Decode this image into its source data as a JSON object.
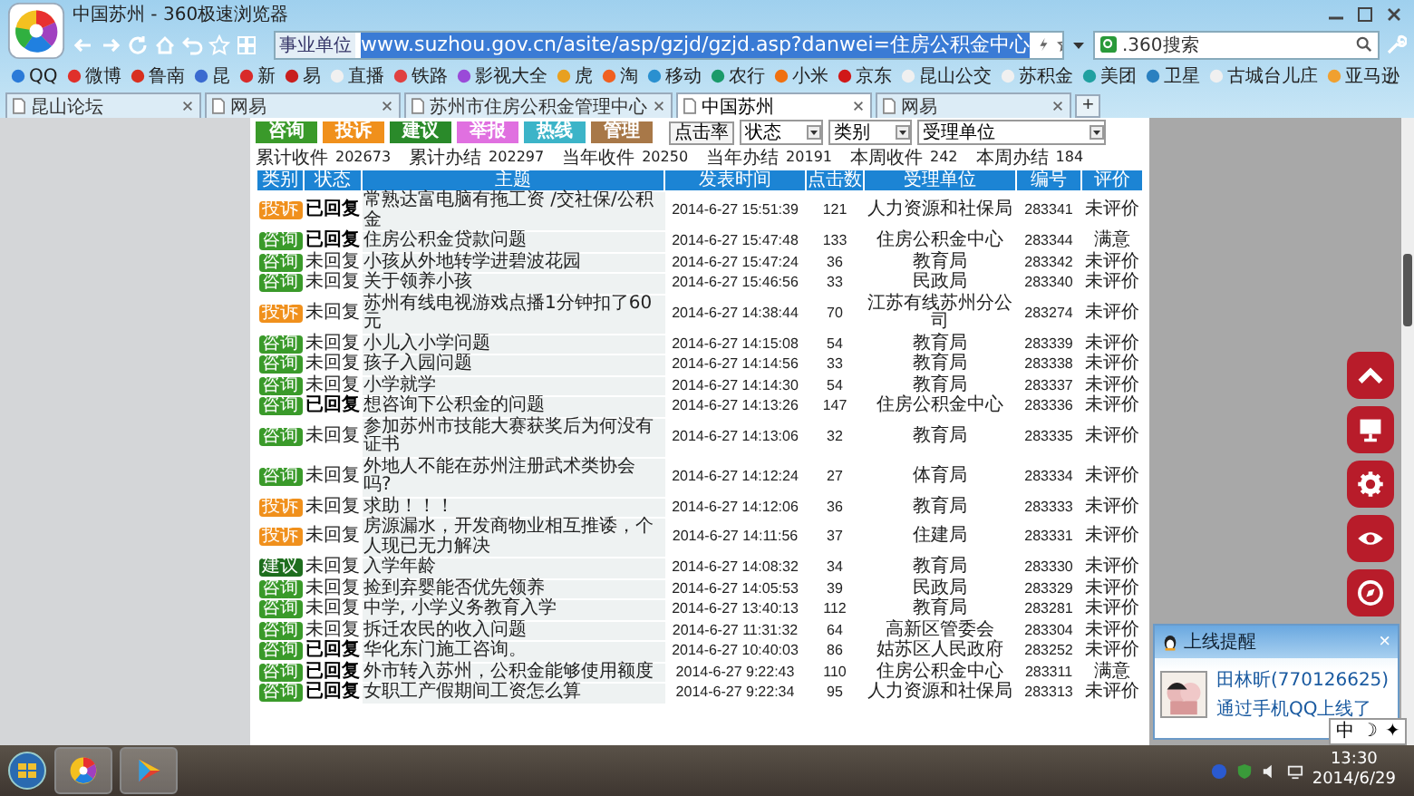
{
  "window": {
    "title": "中国苏州 - 360极速浏览器"
  },
  "address_bar": {
    "tag": "事业单位",
    "url": "www.suzhou.gov.cn/asite/asp/gzjd/gzjd.asp?danwei=住房公积金中心"
  },
  "search": {
    "value": ".360搜索"
  },
  "bookmarks": [
    {
      "label": "QQ",
      "color": "#2a7ad8"
    },
    {
      "label": "微博",
      "color": "#e0302a"
    },
    {
      "label": "鲁南",
      "color": "#d83020"
    },
    {
      "label": "昆",
      "color": "#3a6ad0"
    },
    {
      "label": "新",
      "color": "#d82a2a"
    },
    {
      "label": "易",
      "color": "#c81e1e"
    },
    {
      "label": "直播",
      "color": "#f0f0f0"
    },
    {
      "label": "铁路",
      "color": "#e04040"
    },
    {
      "label": "影视大全",
      "color": "#9a4ad8"
    },
    {
      "label": "虎",
      "color": "#e8a020"
    },
    {
      "label": "淘",
      "color": "#f06020"
    },
    {
      "label": "移动",
      "color": "#2a90d0"
    },
    {
      "label": "农行",
      "color": "#1a9a6a"
    },
    {
      "label": "小米",
      "color": "#f07010"
    },
    {
      "label": "京东",
      "color": "#d01818"
    },
    {
      "label": "昆山公交",
      "color": "#f0f0f0"
    },
    {
      "label": "苏积金",
      "color": "#f0f0f0"
    },
    {
      "label": "美团",
      "color": "#20a0a0"
    },
    {
      "label": "卫星",
      "color": "#2a80c0"
    },
    {
      "label": "古城台儿庄",
      "color": "#f0f0f0"
    },
    {
      "label": "亚马逊",
      "color": "#f0a030"
    }
  ],
  "tabs": [
    {
      "label": "昆山论坛",
      "selected": false
    },
    {
      "label": "网易",
      "selected": false
    },
    {
      "label": "苏州市住房公积金管理中心",
      "selected": false
    },
    {
      "label": "中国苏州",
      "selected": true
    },
    {
      "label": "网易",
      "selected": false
    }
  ],
  "new_tab": "+",
  "page": {
    "category_buttons": [
      {
        "label": "咨询",
        "color": "#3a9a2a"
      },
      {
        "label": "投诉",
        "color": "#f0901c"
      },
      {
        "label": "建议",
        "color": "#2a8a2a"
      },
      {
        "label": "举报",
        "color": "#e070e0"
      },
      {
        "label": "热线",
        "color": "#3cb4c8"
      },
      {
        "label": "管理",
        "color": "#a87848"
      }
    ],
    "sort_button": "点击率",
    "filters": [
      "状态",
      "类别",
      "受理单位"
    ],
    "stats": [
      {
        "label": "累计收件",
        "value": "202673"
      },
      {
        "label": "累计办结",
        "value": "202297"
      },
      {
        "label": "当年收件",
        "value": "20250"
      },
      {
        "label": "当年办结",
        "value": "20191"
      },
      {
        "label": "本周收件",
        "value": "242"
      },
      {
        "label": "本周办结",
        "value": "184"
      }
    ],
    "columns": [
      "类别",
      "状态",
      "主题",
      "发表时间",
      "点击数",
      "受理单位",
      "编号",
      "评价"
    ],
    "rows": [
      {
        "category": {
          "label": "投诉",
          "color": "#f0901c"
        },
        "status": "已回复",
        "replied": true,
        "subject": "常熟达富电脑有拖工资 /交社保/公积金",
        "time": "2014-6-27 15:51:39",
        "clicks": "121",
        "unit": "人力资源和社保局",
        "number": "283341",
        "rating": "未评价"
      },
      {
        "category": {
          "label": "咨询",
          "color": "#3a9a2a"
        },
        "status": "已回复",
        "replied": true,
        "subject": "住房公积金贷款问题",
        "time": "2014-6-27 15:47:48",
        "clicks": "133",
        "unit": "住房公积金中心",
        "number": "283344",
        "rating": "满意"
      },
      {
        "category": {
          "label": "咨询",
          "color": "#3a9a2a"
        },
        "status": "未回复",
        "replied": false,
        "subject": "小孩从外地转学进碧波花园",
        "time": "2014-6-27 15:47:24",
        "clicks": "36",
        "unit": "教育局",
        "number": "283342",
        "rating": "未评价"
      },
      {
        "category": {
          "label": "咨询",
          "color": "#3a9a2a"
        },
        "status": "未回复",
        "replied": false,
        "subject": "关于领养小孩",
        "time": "2014-6-27 15:46:56",
        "clicks": "33",
        "unit": "民政局",
        "number": "283340",
        "rating": "未评价"
      },
      {
        "category": {
          "label": "投诉",
          "color": "#f0901c"
        },
        "status": "未回复",
        "replied": false,
        "subject": "苏州有线电视游戏点播1分钟扣了60元",
        "time": "2014-6-27 14:38:44",
        "clicks": "70",
        "unit": "江苏有线苏州分公司",
        "number": "283274",
        "rating": "未评价"
      },
      {
        "category": {
          "label": "咨询",
          "color": "#3a9a2a"
        },
        "status": "未回复",
        "replied": false,
        "subject": "小儿入小学问题",
        "time": "2014-6-27 14:15:08",
        "clicks": "54",
        "unit": "教育局",
        "number": "283339",
        "rating": "未评价"
      },
      {
        "category": {
          "label": "咨询",
          "color": "#3a9a2a"
        },
        "status": "未回复",
        "replied": false,
        "subject": "孩子入园问题",
        "time": "2014-6-27 14:14:56",
        "clicks": "33",
        "unit": "教育局",
        "number": "283338",
        "rating": "未评价"
      },
      {
        "category": {
          "label": "咨询",
          "color": "#3a9a2a"
        },
        "status": "未回复",
        "replied": false,
        "subject": "小学就学",
        "time": "2014-6-27 14:14:30",
        "clicks": "54",
        "unit": "教育局",
        "number": "283337",
        "rating": "未评价"
      },
      {
        "category": {
          "label": "咨询",
          "color": "#3a9a2a"
        },
        "status": "已回复",
        "replied": true,
        "subject": "想咨询下公积金的问题",
        "time": "2014-6-27 14:13:26",
        "clicks": "147",
        "unit": "住房公积金中心",
        "number": "283336",
        "rating": "未评价"
      },
      {
        "category": {
          "label": "咨询",
          "color": "#3a9a2a"
        },
        "status": "未回复",
        "replied": false,
        "subject": "参加苏州市技能大赛获奖后为何没有证书",
        "time": "2014-6-27 14:13:06",
        "clicks": "32",
        "unit": "教育局",
        "number": "283335",
        "rating": "未评价"
      },
      {
        "category": {
          "label": "咨询",
          "color": "#3a9a2a"
        },
        "status": "未回复",
        "replied": false,
        "subject": "外地人不能在苏州注册武术类协会吗?",
        "time": "2014-6-27 14:12:24",
        "clicks": "27",
        "unit": "体育局",
        "number": "283334",
        "rating": "未评价"
      },
      {
        "category": {
          "label": "投诉",
          "color": "#f0901c"
        },
        "status": "未回复",
        "replied": false,
        "subject": "求助！！！",
        "time": "2014-6-27 14:12:06",
        "clicks": "36",
        "unit": "教育局",
        "number": "283333",
        "rating": "未评价"
      },
      {
        "category": {
          "label": "投诉",
          "color": "#f0901c"
        },
        "status": "未回复",
        "replied": false,
        "subject": "房源漏水，开发商物业相互推诿，个人现已无力解决",
        "time": "2014-6-27 14:11:56",
        "clicks": "37",
        "unit": "住建局",
        "number": "283331",
        "rating": "未评价"
      },
      {
        "category": {
          "label": "建议",
          "color": "#1e6e1e"
        },
        "status": "未回复",
        "replied": false,
        "subject": "入学年龄",
        "time": "2014-6-27 14:08:32",
        "clicks": "34",
        "unit": "教育局",
        "number": "283330",
        "rating": "未评价"
      },
      {
        "category": {
          "label": "咨询",
          "color": "#3a9a2a"
        },
        "status": "未回复",
        "replied": false,
        "subject": "捡到弃婴能否优先领养",
        "time": "2014-6-27 14:05:53",
        "clicks": "39",
        "unit": "民政局",
        "number": "283329",
        "rating": "未评价"
      },
      {
        "category": {
          "label": "咨询",
          "color": "#3a9a2a"
        },
        "status": "未回复",
        "replied": false,
        "subject": "中学, 小学义务教育入学",
        "time": "2014-6-27 13:40:13",
        "clicks": "112",
        "unit": "教育局",
        "number": "283281",
        "rating": "未评价"
      },
      {
        "category": {
          "label": "咨询",
          "color": "#3a9a2a"
        },
        "status": "未回复",
        "replied": false,
        "subject": "拆迁农民的收入问题",
        "time": "2014-6-27 11:31:32",
        "clicks": "64",
        "unit": "高新区管委会",
        "number": "283304",
        "rating": "未评价"
      },
      {
        "category": {
          "label": "咨询",
          "color": "#3a9a2a"
        },
        "status": "已回复",
        "replied": true,
        "subject": "华化东门施工咨询。",
        "time": "2014-6-27 10:40:03",
        "clicks": "86",
        "unit": "姑苏区人民政府",
        "number": "283252",
        "rating": "未评价"
      },
      {
        "category": {
          "label": "咨询",
          "color": "#3a9a2a"
        },
        "status": "已回复",
        "replied": true,
        "subject": "外市转入苏州，公积金能够使用额度",
        "time": "2014-6-27 9:22:43",
        "clicks": "110",
        "unit": "住房公积金中心",
        "number": "283311",
        "rating": "满意"
      },
      {
        "category": {
          "label": "咨询",
          "color": "#3a9a2a"
        },
        "status": "已回复",
        "replied": true,
        "subject": "女职工产假期间工资怎么算",
        "time": "2014-6-27 9:22:34",
        "clicks": "95",
        "unit": "人力资源和社保局",
        "number": "283313",
        "rating": "未评价"
      }
    ]
  },
  "notification": {
    "title": "上线提醒",
    "close": "×",
    "name": "田林昕(770126625)",
    "message": "通过手机QQ上线了"
  },
  "ime_bar": [
    "中",
    "☽",
    "✦"
  ],
  "clock": {
    "time": "13:30",
    "date": "2014/6/29"
  }
}
